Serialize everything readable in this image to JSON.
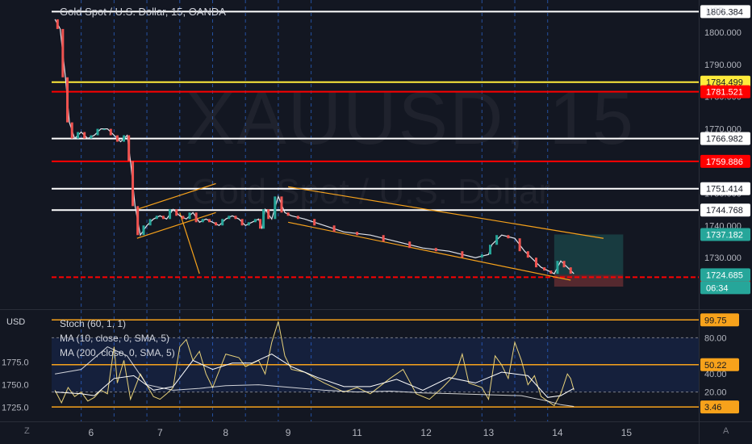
{
  "header": {
    "title": "Gold Spot / U.S. Dollar, 15, OANDA",
    "currency": "USD",
    "sub_currency": "USD"
  },
  "watermark": {
    "symbol": "XAUUSD, 15",
    "name": "Gold Spot / U.S. Dollar"
  },
  "indicators": {
    "stoch": "Stoch (60, 1, 1)",
    "ma10": "MA (10, close, 0, SMA, 5)",
    "ma200": "MA (200, close, 0, SMA, 5)"
  },
  "corner": {
    "left": "Z",
    "right": "A"
  },
  "countdown": "06:34",
  "colors": {
    "background": "#131722",
    "candle_up": "#26a69a",
    "candle_down": "#ef5350",
    "red_level": "#ff0000",
    "yellow_level": "#ffeb3b",
    "white_level": "#ffffff",
    "trendline": "#f7a21b",
    "stoch_line": "#e8d27a",
    "grid_divider": "#2a5fbf"
  },
  "chart_data": [
    {
      "type": "line",
      "title": "Gold Spot / U.S. Dollar, 15, OANDA",
      "xlabel": "",
      "ylabel": "USD",
      "ylim": [
        1714,
        1810
      ],
      "x_ticks": [
        "6",
        "7",
        "8",
        "9",
        "11",
        "12",
        "13",
        "14",
        "15"
      ],
      "y_ticks": [
        1730.0,
        1740.0,
        1750.0,
        1760.0,
        1770.0,
        1780.0,
        1790.0,
        1800.0
      ],
      "grid": false,
      "horizontal_levels": [
        {
          "value": 1806.384,
          "label": "1806.384",
          "color": "#ffffff"
        },
        {
          "value": 1784.499,
          "label": "1784.499",
          "color": "#ffeb3b"
        },
        {
          "value": 1781.521,
          "label": "1781.521",
          "color": "#ff0000"
        },
        {
          "value": 1766.982,
          "label": "1766.982",
          "color": "#ffffff"
        },
        {
          "value": 1759.886,
          "label": "1759.886",
          "color": "#ff0000"
        },
        {
          "value": 1751.414,
          "label": "1751.414",
          "color": "#ffffff"
        },
        {
          "value": 1744.768,
          "label": "1744.768",
          "color": "#ffffff"
        },
        {
          "value": 1723.922,
          "label": "1723.922",
          "color": "#ff0000"
        }
      ],
      "price_labels": [
        {
          "value": 1737.182,
          "label": "1737.182",
          "color": "#26a69a"
        },
        {
          "value": 1724.685,
          "label": "1724.685",
          "color": "#26a69a"
        }
      ],
      "series": [
        {
          "name": "XAUUSD",
          "points": [
            [
              5.4,
              1804
            ],
            [
              5.48,
              1801
            ],
            [
              5.56,
              1786
            ],
            [
              5.62,
              1772
            ],
            [
              5.7,
              1767
            ],
            [
              5.8,
              1769
            ],
            [
              5.9,
              1767
            ],
            [
              6.0,
              1768
            ],
            [
              6.1,
              1770
            ],
            [
              6.2,
              1770
            ],
            [
              6.3,
              1768
            ],
            [
              6.4,
              1766
            ],
            [
              6.5,
              1768
            ],
            [
              6.55,
              1760
            ],
            [
              6.62,
              1746
            ],
            [
              6.7,
              1737
            ],
            [
              6.8,
              1740
            ],
            [
              6.9,
              1742
            ],
            [
              7.0,
              1743
            ],
            [
              7.1,
              1742
            ],
            [
              7.2,
              1745
            ],
            [
              7.3,
              1743
            ],
            [
              7.4,
              1742
            ],
            [
              7.5,
              1744
            ],
            [
              7.6,
              1741
            ],
            [
              7.7,
              1742
            ],
            [
              7.8,
              1741
            ],
            [
              7.9,
              1740
            ],
            [
              8.0,
              1742
            ],
            [
              8.1,
              1743
            ],
            [
              8.2,
              1742
            ],
            [
              8.3,
              1740
            ],
            [
              8.4,
              1741
            ],
            [
              8.5,
              1742
            ],
            [
              8.55,
              1739
            ],
            [
              8.6,
              1745
            ],
            [
              8.7,
              1742
            ],
            [
              8.8,
              1749
            ],
            [
              8.9,
              1744
            ],
            [
              9.0,
              1743
            ],
            [
              9.2,
              1742
            ],
            [
              9.5,
              1740
            ],
            [
              9.8,
              1738
            ],
            [
              10.2,
              1737
            ],
            [
              10.6,
              1735
            ],
            [
              11.0,
              1733
            ],
            [
              11.4,
              1732
            ],
            [
              11.8,
              1730
            ],
            [
              12.0,
              1731
            ],
            [
              12.05,
              1734
            ],
            [
              12.2,
              1737
            ],
            [
              12.4,
              1736
            ],
            [
              12.55,
              1732
            ],
            [
              12.65,
              1730
            ],
            [
              12.8,
              1727
            ],
            [
              12.9,
              1726
            ],
            [
              13.0,
              1725
            ],
            [
              13.1,
              1729
            ],
            [
              13.2,
              1727
            ],
            [
              13.3,
              1725
            ]
          ]
        }
      ]
    },
    {
      "type": "line",
      "title": "Stoch (60, 1, 1)",
      "xlabel": "",
      "ylabel": "USD",
      "ylim": [
        0,
        100
      ],
      "y_ticks_left": [
        1725.0,
        1750.0,
        1775.0
      ],
      "y_ticks_right": [
        20.0,
        40.0,
        80.0
      ],
      "horizontal_levels": [
        {
          "value": 99.75,
          "label": "99.75",
          "color": "#f7a21b"
        },
        {
          "value": 50.22,
          "label": "50.22",
          "color": "#f7a21b"
        },
        {
          "value": 3.46,
          "label": "3.46",
          "color": "#f7a21b"
        }
      ],
      "band": [
        20,
        80
      ],
      "series": [
        {
          "name": "Stoch (60, 1, 1)",
          "points": [
            [
              5.4,
              22
            ],
            [
              5.5,
              8
            ],
            [
              5.6,
              25
            ],
            [
              5.7,
              15
            ],
            [
              5.8,
              20
            ],
            [
              5.9,
              10
            ],
            [
              6.0,
              14
            ],
            [
              6.1,
              22
            ],
            [
              6.2,
              18
            ],
            [
              6.3,
              70
            ],
            [
              6.35,
              30
            ],
            [
              6.45,
              55
            ],
            [
              6.55,
              12
            ],
            [
              6.7,
              40
            ],
            [
              6.9,
              15
            ],
            [
              7.0,
              12
            ],
            [
              7.1,
              18
            ],
            [
              7.2,
              25
            ],
            [
              7.3,
              70
            ],
            [
              7.4,
              78
            ],
            [
              7.5,
              55
            ],
            [
              7.6,
              65
            ],
            [
              7.7,
              40
            ],
            [
              7.8,
              25
            ],
            [
              8.0,
              62
            ],
            [
              8.2,
              58
            ],
            [
              8.3,
              48
            ],
            [
              8.5,
              55
            ],
            [
              8.6,
              40
            ],
            [
              8.7,
              75
            ],
            [
              8.8,
              98
            ],
            [
              8.9,
              60
            ],
            [
              9.0,
              45
            ],
            [
              9.2,
              42
            ],
            [
              9.5,
              30
            ],
            [
              9.8,
              20
            ],
            [
              10.0,
              25
            ],
            [
              10.2,
              18
            ],
            [
              10.5,
              35
            ],
            [
              10.7,
              45
            ],
            [
              10.9,
              18
            ],
            [
              11.1,
              12
            ],
            [
              11.3,
              25
            ],
            [
              11.5,
              40
            ],
            [
              11.6,
              62
            ],
            [
              11.7,
              30
            ],
            [
              11.9,
              25
            ],
            [
              12.0,
              12
            ],
            [
              12.1,
              60
            ],
            [
              12.2,
              50
            ],
            [
              12.3,
              35
            ],
            [
              12.4,
              75
            ],
            [
              12.5,
              55
            ],
            [
              12.6,
              28
            ],
            [
              12.7,
              38
            ],
            [
              12.8,
              15
            ],
            [
              12.9,
              10
            ],
            [
              13.0,
              5
            ],
            [
              13.1,
              18
            ],
            [
              13.2,
              40
            ],
            [
              13.25,
              35
            ],
            [
              13.3,
              22
            ]
          ]
        },
        {
          "name": "MA (10, close, 0, SMA, 5)",
          "points": [
            [
              5.4,
              20
            ],
            [
              5.8,
              18
            ],
            [
              6.0,
              16
            ],
            [
              6.3,
              35
            ],
            [
              6.6,
              38
            ],
            [
              6.9,
              22
            ],
            [
              7.2,
              26
            ],
            [
              7.5,
              55
            ],
            [
              7.8,
              45
            ],
            [
              8.1,
              52
            ],
            [
              8.4,
              52
            ],
            [
              8.7,
              62
            ],
            [
              9.0,
              48
            ],
            [
              9.4,
              36
            ],
            [
              9.8,
              26
            ],
            [
              10.2,
              26
            ],
            [
              10.6,
              34
            ],
            [
              11.0,
              22
            ],
            [
              11.4,
              36
            ],
            [
              11.8,
              30
            ],
            [
              12.2,
              42
            ],
            [
              12.6,
              38
            ],
            [
              12.9,
              14
            ],
            [
              13.1,
              16
            ],
            [
              13.3,
              24
            ]
          ]
        },
        {
          "name": "MA (200, close, 0, SMA, 5)",
          "points": [
            [
              5.4,
              40
            ],
            [
              5.8,
              45
            ],
            [
              6.2,
              70
            ],
            [
              6.5,
              60
            ],
            [
              6.8,
              28
            ],
            [
              7.2,
              22
            ],
            [
              7.6,
              24
            ],
            [
              8.0,
              27
            ],
            [
              8.5,
              28
            ],
            [
              9.0,
              25
            ],
            [
              9.5,
              22
            ],
            [
              10.0,
              20
            ],
            [
              10.5,
              21
            ],
            [
              11.0,
              19
            ],
            [
              11.5,
              18
            ],
            [
              12.0,
              17
            ],
            [
              12.5,
              16
            ],
            [
              12.9,
              10
            ],
            [
              13.1,
              6
            ],
            [
              13.3,
              4
            ]
          ]
        }
      ]
    }
  ]
}
